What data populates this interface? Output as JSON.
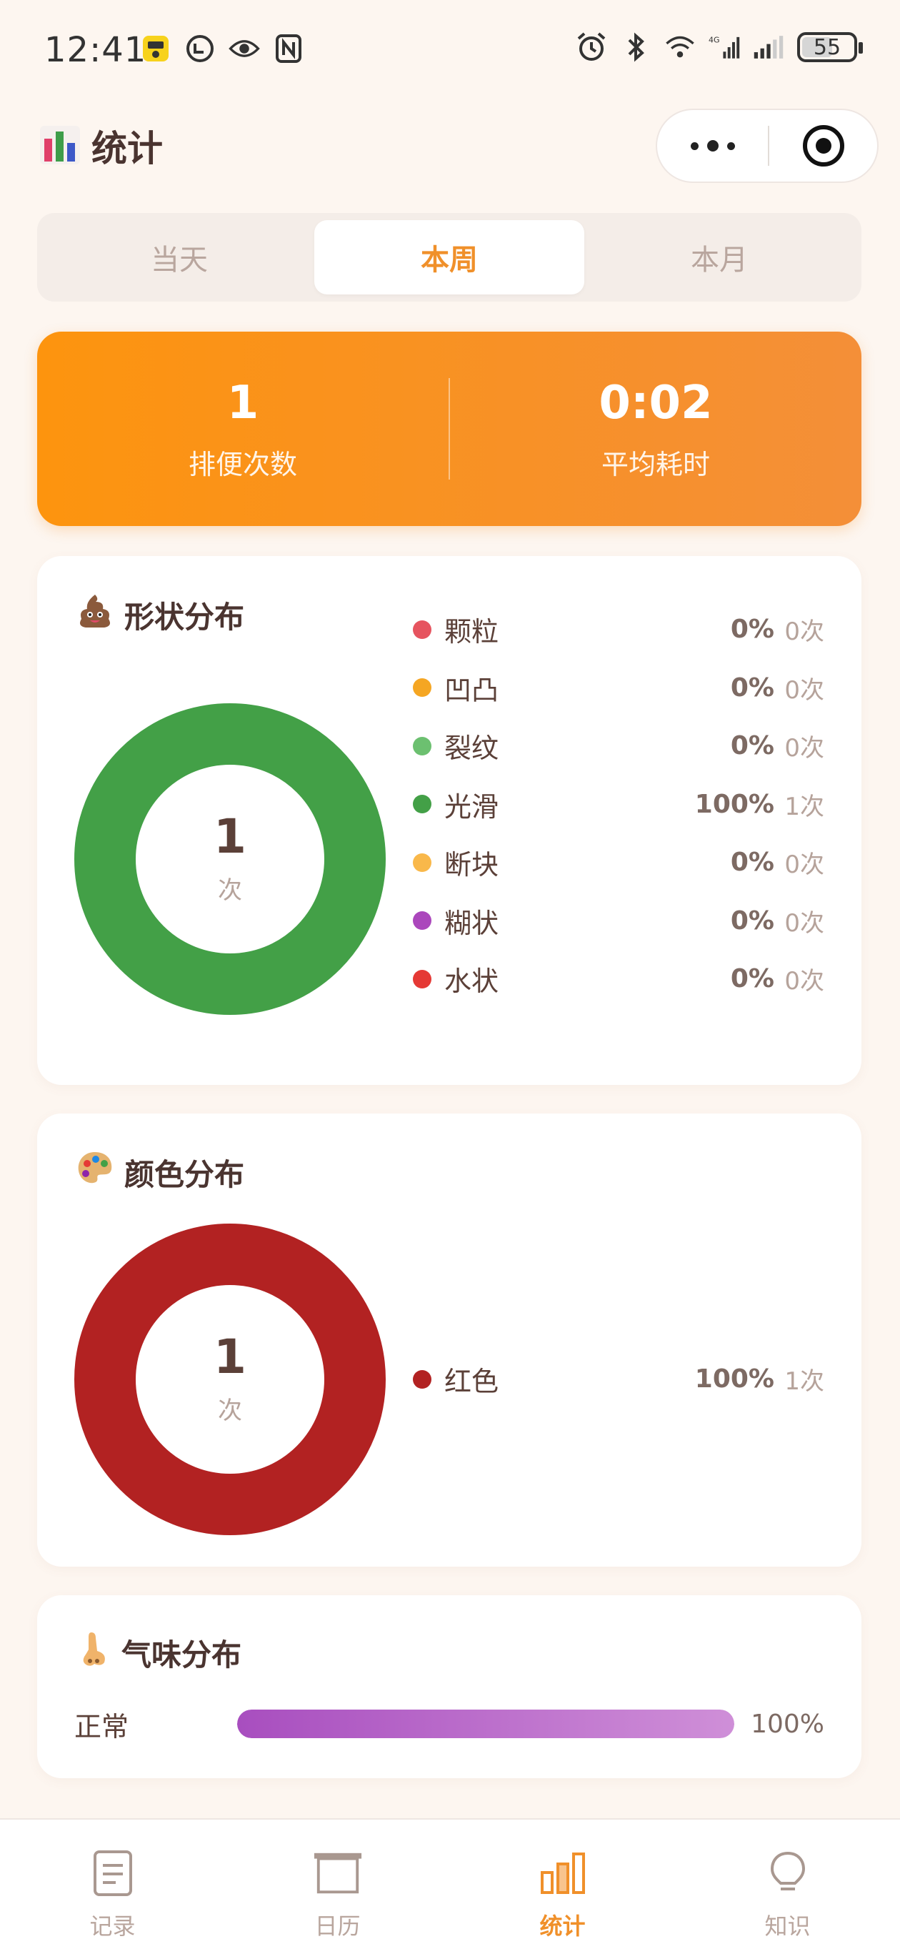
{
  "status_bar": {
    "time": "12:41",
    "network": "4G",
    "battery": "55"
  },
  "header": {
    "title": "统计",
    "title_icon": "bar-chart-icon"
  },
  "tabs": [
    {
      "label": "当天",
      "active": false
    },
    {
      "label": "本周",
      "active": true
    },
    {
      "label": "本月",
      "active": false
    }
  ],
  "summary": {
    "count_value": "1",
    "count_label": "排便次数",
    "avg_value": "0:02",
    "avg_label": "平均耗时"
  },
  "shape": {
    "title": "形状分布",
    "icon": "poop-icon",
    "total": "1",
    "unit": "次",
    "items": [
      {
        "label": "颗粒",
        "pct": "0%",
        "count": "0次",
        "color": "#e6545f",
        "fraction": 0
      },
      {
        "label": "凹凸",
        "pct": "0%",
        "count": "0次",
        "color": "#f5a623",
        "fraction": 0
      },
      {
        "label": "裂纹",
        "pct": "0%",
        "count": "0次",
        "color": "#6cc070",
        "fraction": 0
      },
      {
        "label": "光滑",
        "pct": "100%",
        "count": "1次",
        "color": "#43a047",
        "fraction": 1
      },
      {
        "label": "断块",
        "pct": "0%",
        "count": "0次",
        "color": "#f9b84a",
        "fraction": 0
      },
      {
        "label": "糊状",
        "pct": "0%",
        "count": "0次",
        "color": "#ab47bc",
        "fraction": 0
      },
      {
        "label": "水状",
        "pct": "0%",
        "count": "0次",
        "color": "#e53935",
        "fraction": 0
      }
    ]
  },
  "color": {
    "title": "颜色分布",
    "icon": "palette-icon",
    "total": "1",
    "unit": "次",
    "items": [
      {
        "label": "红色",
        "pct": "100%",
        "count": "1次",
        "color": "#b22222",
        "fraction": 1
      }
    ]
  },
  "smell": {
    "title": "气味分布",
    "icon": "nose-icon",
    "items": [
      {
        "label": "正常",
        "pct": "100%",
        "fraction": 1
      }
    ]
  },
  "nav": [
    {
      "label": "记录",
      "icon": "record-icon",
      "active": false
    },
    {
      "label": "日历",
      "icon": "calendar-icon",
      "active": false
    },
    {
      "label": "统计",
      "icon": "stats-icon",
      "active": true
    },
    {
      "label": "知识",
      "icon": "bulb-icon",
      "active": false
    }
  ],
  "chart_data": [
    {
      "type": "pie",
      "categories": [
        "颗粒",
        "凹凸",
        "裂纹",
        "光滑",
        "断块",
        "糊状",
        "水状"
      ],
      "values": [
        0,
        0,
        0,
        1,
        0,
        0,
        0
      ],
      "title": "形状分布"
    },
    {
      "type": "pie",
      "categories": [
        "红色"
      ],
      "values": [
        1
      ],
      "title": "颜色分布"
    }
  ]
}
